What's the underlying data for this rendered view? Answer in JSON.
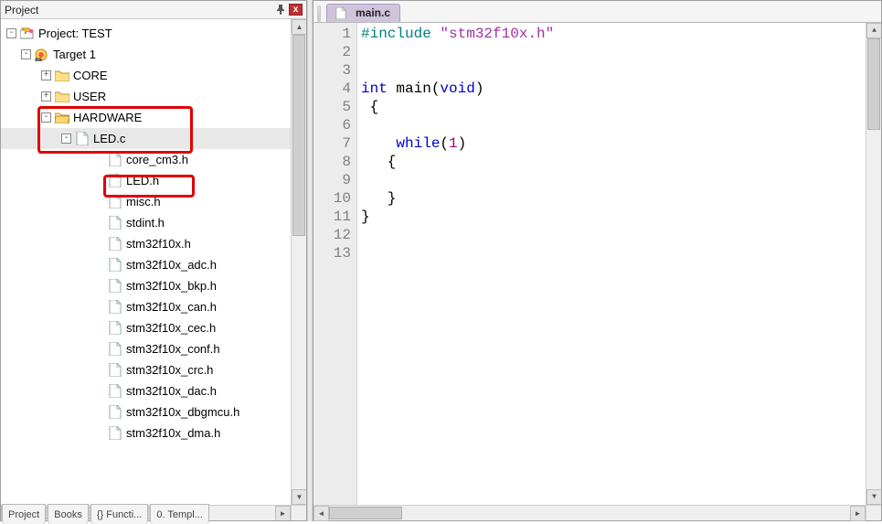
{
  "panel": {
    "title": "Project"
  },
  "tree": {
    "root": {
      "label": "Project: TEST"
    },
    "target": {
      "label": "Target 1"
    },
    "core": {
      "label": "CORE"
    },
    "user": {
      "label": "USER"
    },
    "hw": {
      "label": "HARDWARE"
    },
    "ledc": {
      "label": "LED.c"
    },
    "files": [
      "core_cm3.h",
      "LED.h",
      "misc.h",
      "stdint.h",
      "stm32f10x.h",
      "stm32f10x_adc.h",
      "stm32f10x_bkp.h",
      "stm32f10x_can.h",
      "stm32f10x_cec.h",
      "stm32f10x_conf.h",
      "stm32f10x_crc.h",
      "stm32f10x_dac.h",
      "stm32f10x_dbgmcu.h",
      "stm32f10x_dma.h"
    ]
  },
  "bottom_tabs": [
    "Project",
    "Books",
    "{} Functi...",
    "0. Templ..."
  ],
  "editor": {
    "tab": "main.c",
    "lines": [
      {
        "n": 1,
        "html": "<span class='c-pp'>#include</span> <span class='c-str'>&quot;stm32f10x.h&quot;</span>"
      },
      {
        "n": 2,
        "html": ""
      },
      {
        "n": 3,
        "html": ""
      },
      {
        "n": 4,
        "html": "<span class='c-kw'>int</span> main(<span class='c-kw'>void</span>)"
      },
      {
        "n": 5,
        "html": " {"
      },
      {
        "n": 6,
        "html": ""
      },
      {
        "n": 7,
        "html": "    <span class='c-kw'>while</span>(<span class='c-num'>1</span>)"
      },
      {
        "n": 8,
        "html": "   {"
      },
      {
        "n": 9,
        "html": ""
      },
      {
        "n": 10,
        "html": "   }"
      },
      {
        "n": 11,
        "html": "}"
      },
      {
        "n": 12,
        "html": ""
      },
      {
        "n": 13,
        "html": ""
      }
    ]
  }
}
